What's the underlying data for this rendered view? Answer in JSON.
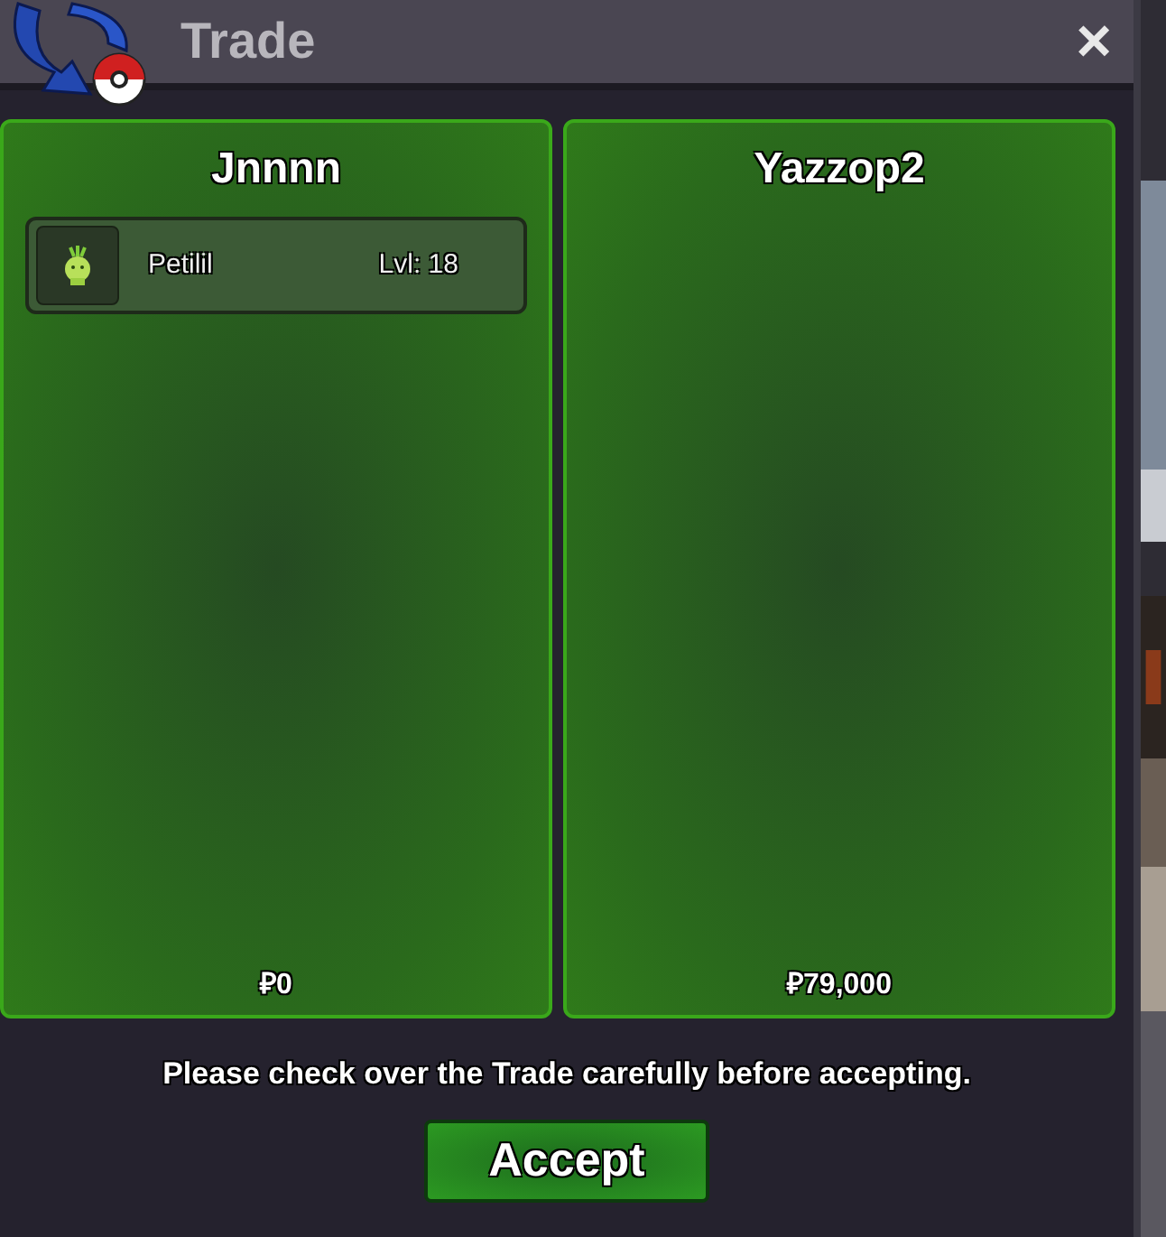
{
  "window": {
    "title": "Trade",
    "close": "×"
  },
  "offers": [
    {
      "player": "Jnnnn",
      "items": [
        {
          "name": "Petilil",
          "level": "Lvl: 18"
        }
      ],
      "money": "₽0"
    },
    {
      "player": "Yazzop2",
      "money": "₽79,000"
    }
  ],
  "notice": "Please check over the Trade carefully before accepting.",
  "accept_button": "Accept"
}
